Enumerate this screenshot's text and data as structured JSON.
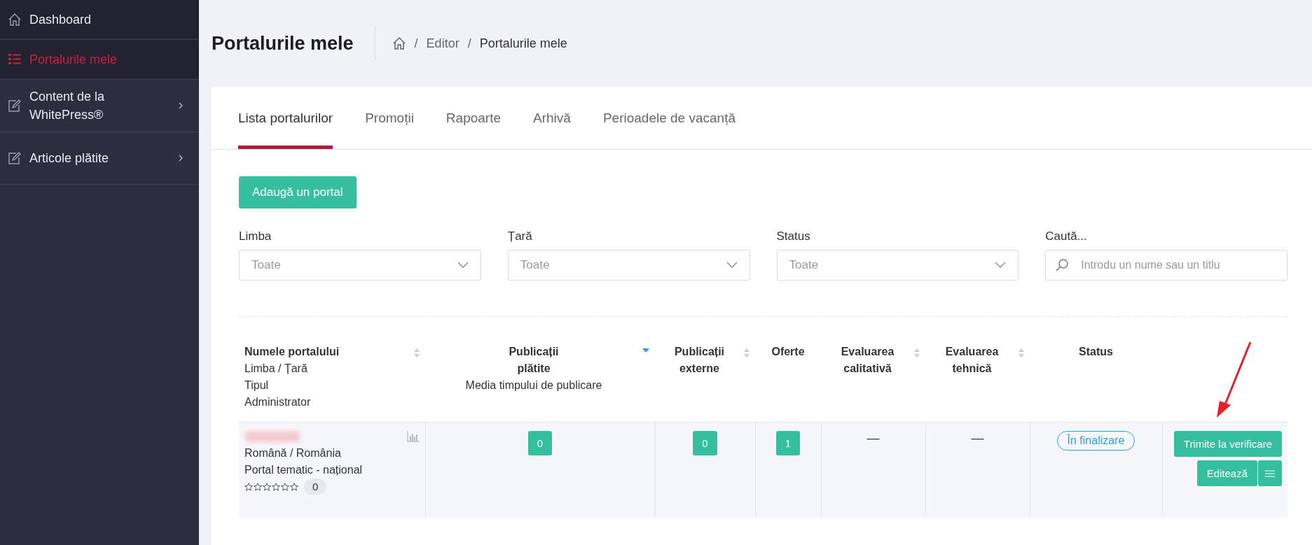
{
  "sidebar": {
    "items": [
      {
        "label": "Dashboard",
        "selected": false,
        "submenu": false
      },
      {
        "label": "Portalurile mele",
        "selected": true,
        "submenu": false
      },
      {
        "label": "Content de la WhitePress®",
        "selected": false,
        "submenu": true
      },
      {
        "label": "Articole plătite",
        "selected": false,
        "submenu": true
      }
    ]
  },
  "header": {
    "title": "Portalurile mele",
    "breadcrumb": [
      {
        "separator": "/",
        "label": "Editor"
      },
      {
        "separator": "/",
        "label": "Portalurile mele"
      }
    ]
  },
  "tabs": [
    {
      "label": "Lista portalurilor",
      "selected": true
    },
    {
      "label": "Promoții",
      "selected": false
    },
    {
      "label": "Rapoarte",
      "selected": false
    },
    {
      "label": "Arhivă",
      "selected": false
    },
    {
      "label": "Perioadele de vacanță",
      "selected": false
    }
  ],
  "add_button": "Adaugă un portal",
  "filters": [
    {
      "kind": "select",
      "label": "Limba",
      "value": "Toate"
    },
    {
      "kind": "select",
      "label": "Țară",
      "value": "Toate"
    },
    {
      "kind": "select",
      "label": "Status",
      "value": "Toate"
    },
    {
      "kind": "search",
      "label": "Caută...",
      "placeholder": "Introdu un nume sau un titlu"
    }
  ],
  "table": {
    "columns": [
      {
        "lines": [
          "Numele portalului",
          "Limba / Țară",
          "Tipul",
          "Administrator"
        ],
        "kind": "sortable",
        "sorted": false
      },
      {
        "lines": [
          "Publicații",
          "plătite",
          "Media timpului de publicare"
        ],
        "kind": "sortable",
        "sorted": true
      },
      {
        "lines": [
          "Publicații",
          "externe"
        ],
        "kind": "sortable",
        "sorted": false
      },
      {
        "lines": [
          "Oferte"
        ],
        "kind": "plain"
      },
      {
        "lines": [
          "Evaluarea",
          "calitativă"
        ],
        "kind": "sortable",
        "sorted": false
      },
      {
        "lines": [
          "Evaluarea",
          "tehnică"
        ],
        "kind": "sortable",
        "sorted": false
      },
      {
        "lines": [
          "Status"
        ],
        "kind": "plain"
      },
      {
        "kind": "plain"
      }
    ],
    "rows": [
      {
        "language_country": "Română / România",
        "type": "Portal tematic - național",
        "stars": 0,
        "rating_count": "0",
        "paid": "0",
        "external": "0",
        "offers": "1",
        "quality": "—",
        "technical": "—",
        "status": "În finalizare",
        "actions": {
          "submit": "Trimite la verificare",
          "edit": "Editează"
        }
      }
    ]
  }
}
